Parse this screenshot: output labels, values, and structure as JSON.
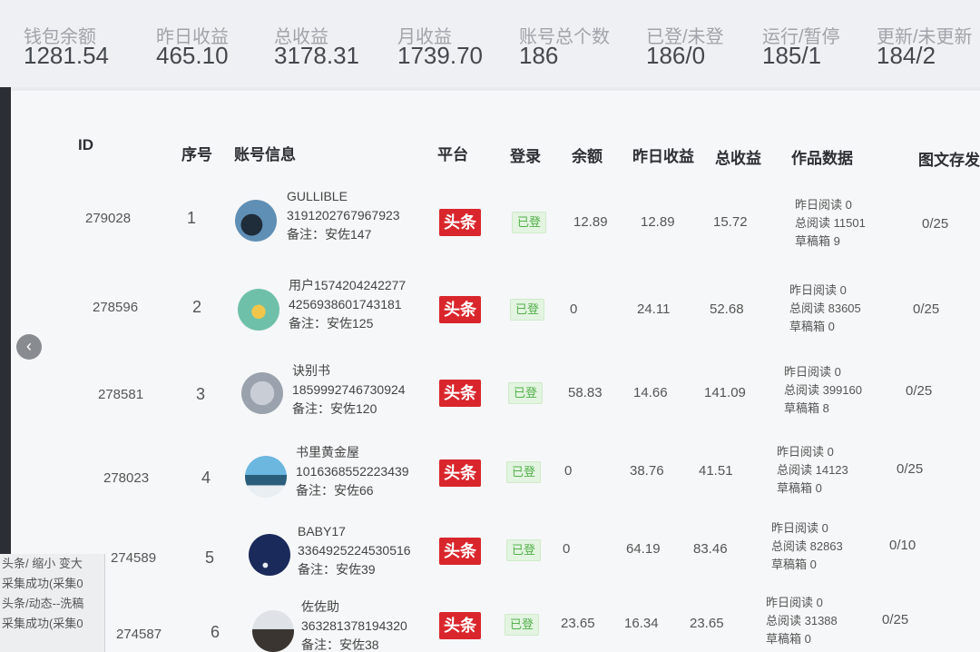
{
  "stats": [
    {
      "label": "钱包余额",
      "value": "1281.54"
    },
    {
      "label": "昨日收益",
      "value": "465.10"
    },
    {
      "label": "总收益",
      "value": "3178.31"
    },
    {
      "label": "月收益",
      "value": "1739.70"
    },
    {
      "label": "账号总个数",
      "value": "186"
    },
    {
      "label": "已登/未登",
      "value": "186/0"
    },
    {
      "label": "运行/暂停",
      "value": "185/1"
    },
    {
      "label": "更新/未更新",
      "value": "184/2"
    }
  ],
  "table": {
    "headers": {
      "id": "ID",
      "seq": "序号",
      "account": "账号信息",
      "platform": "平台",
      "login": "登录",
      "balance": "余额",
      "yesterday": "昨日收益",
      "total": "总收益",
      "works": "作品数据",
      "draft": "图文存发"
    },
    "rows": [
      {
        "id": "279028",
        "seq": "1",
        "name": "GULLIBLE",
        "uid": "3191202767967923",
        "note": "备注：安佐147",
        "platform": "头条",
        "login": "已登",
        "balance": "12.89",
        "yesterday": "12.89",
        "total": "15.72",
        "read_yesterday": "昨日阅读 0",
        "read_total": "总阅读 11501",
        "drafts": "草稿箱 9",
        "draft_ratio": "0/25"
      },
      {
        "id": "278596",
        "seq": "2",
        "name": "用户1574204242277",
        "uid": "4256938601743181",
        "note": "备注：安佐125",
        "platform": "头条",
        "login": "已登",
        "balance": "0",
        "yesterday": "24.11",
        "total": "52.68",
        "read_yesterday": "昨日阅读 0",
        "read_total": "总阅读 83605",
        "drafts": "草稿箱 0",
        "draft_ratio": "0/25"
      },
      {
        "id": "278581",
        "seq": "3",
        "name": "诀别书",
        "uid": "1859992746730924",
        "note": "备注：安佐120",
        "platform": "头条",
        "login": "已登",
        "balance": "58.83",
        "yesterday": "14.66",
        "total": "141.09",
        "read_yesterday": "昨日阅读 0",
        "read_total": "总阅读 399160",
        "drafts": "草稿箱 8",
        "draft_ratio": "0/25"
      },
      {
        "id": "278023",
        "seq": "4",
        "name": "书里黄金屋",
        "uid": "1016368552223439",
        "note": "备注：安佐66",
        "platform": "头条",
        "login": "已登",
        "balance": "0",
        "yesterday": "38.76",
        "total": "41.51",
        "read_yesterday": "昨日阅读 0",
        "read_total": "总阅读 14123",
        "drafts": "草稿箱 0",
        "draft_ratio": "0/25"
      },
      {
        "id": "274589",
        "seq": "5",
        "name": "BABY17",
        "uid": "3364925224530516",
        "note": "备注：安佐39",
        "platform": "头条",
        "login": "已登",
        "balance": "0",
        "yesterday": "64.19",
        "total": "83.46",
        "read_yesterday": "昨日阅读 0",
        "read_total": "总阅读 82863",
        "drafts": "草稿箱 0",
        "draft_ratio": "0/10"
      },
      {
        "id": "274587",
        "seq": "6",
        "name": "佐佐助",
        "uid": "363281378194320",
        "note": "备注：安佐38",
        "platform": "头条",
        "login": "已登",
        "balance": "23.65",
        "yesterday": "16.34",
        "total": "23.65",
        "read_yesterday": "昨日阅读 0",
        "read_total": "总阅读 31388",
        "drafts": "草稿箱 0",
        "draft_ratio": "0/25"
      }
    ]
  },
  "overlay": {
    "arrow": "‹",
    "lines": [
      "头条/ 缩小  变大",
      "采集成功(采集0",
      "头条/动态--洗稿",
      "采集成功(采集0"
    ]
  }
}
